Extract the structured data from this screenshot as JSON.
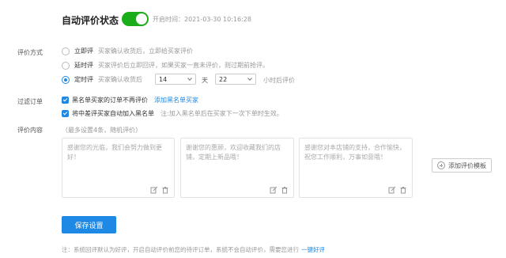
{
  "header": {
    "title": "自动评价状态",
    "toggle_state": "on",
    "start_time": "开启时间：2021-03-30 10:16:28",
    "accent_color": "#1aad19"
  },
  "review_mode": {
    "label": "评价方式",
    "options": [
      {
        "title": "立即评",
        "desc": "买家确认收货后，立即给买家评价",
        "selected": false
      },
      {
        "title": "延时评",
        "desc": "买家评价后立即回评，如果买家一直未评价，则过期前抢评。",
        "selected": false
      },
      {
        "title": "定时评",
        "desc": "买家确认收货后",
        "selected": true
      }
    ],
    "days_value": "14",
    "days_unit": "天",
    "hours_value": "22",
    "hours_suffix": "小时后评价"
  },
  "filter": {
    "label": "过滤订单",
    "blacklist_check": "黑名单买家的订单不再评价",
    "blacklist_link": "添加黑名单买家",
    "auto_blacklist_check": "将中差评买家自动加入黑名单",
    "auto_blacklist_note": "注:加入黑名单后在买家下一次下单时生效。"
  },
  "content": {
    "label": "评价内容",
    "hint": "（最多设置4条，随机评价）",
    "templates": [
      "感谢您的光临，我们会努力做到更好！",
      "谢谢您的惠顾，欢迎收藏我们的店铺，定期上新品哦！",
      "感谢您对本店铺的支持，合作愉快，祝您工作顺利，万事如意哦！"
    ],
    "add_template_label": "添加评价模板"
  },
  "actions": {
    "save_label": "保存设置",
    "primary_color": "#1e88e5"
  },
  "footer": {
    "note": "注：系统回评默认为好评，开启自动评价前您的待评订单，系统不会自动评价，需要您进行",
    "link": "一键好评"
  }
}
